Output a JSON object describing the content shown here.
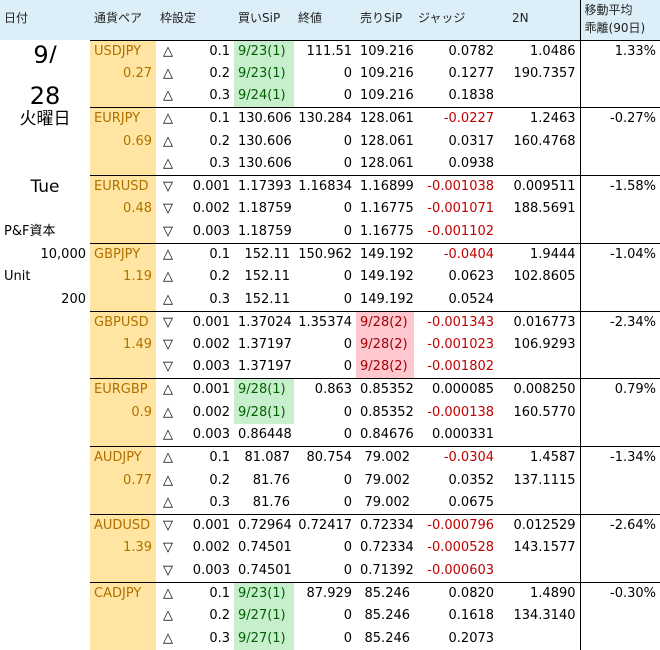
{
  "header": {
    "date": "日付",
    "pair": "通貨ペア",
    "frame": "枠設定",
    "buy_sip": "買いSiP",
    "close": "終値",
    "sell_sip": "売りSiP",
    "judge": "ジャッジ",
    "n2": "2N",
    "ma_line1": "移動平均",
    "ma_line2": "乖離(90日)"
  },
  "left_panel": {
    "date_top": "9/",
    "date_day": "28",
    "weekday_jp": "火曜日",
    "weekday_en": "Tue",
    "capital_label": "P&F資本",
    "capital_value": "10,000",
    "unit_label": "Unit",
    "unit_value": "200"
  },
  "colors": {
    "header_bg": "#dceef8",
    "pair_bg": "#ffe5a1",
    "pair_text": "#b07000",
    "green_bg": "#c7efcd",
    "green_text": "#006100",
    "red_bg": "#ffc7ce",
    "red_text": "#9c0006",
    "negative_text": "#c00000"
  },
  "groups": [
    {
      "pair": "USDJPY",
      "value": "0.27",
      "close": "111.51",
      "ma": "1.33%",
      "rows": [
        {
          "triangle": "△",
          "frame": "0.1",
          "buy": "9/23(1)",
          "buy_hl": "green",
          "sell": "109.216",
          "sell_hl": "",
          "judge": "0.0782",
          "n2": "1.0486"
        },
        {
          "triangle": "△",
          "frame": "0.2",
          "buy": "9/23(1)",
          "buy_hl": "green",
          "close": "0",
          "sell": "109.216",
          "sell_hl": "",
          "judge": "0.1277",
          "n2": "190.7357"
        },
        {
          "triangle": "△",
          "frame": "0.3",
          "buy": "9/24(1)",
          "buy_hl": "green",
          "close": "0",
          "sell": "109.216",
          "sell_hl": "",
          "judge": "0.1838",
          "n2": ""
        }
      ]
    },
    {
      "pair": "EURJPY",
      "value": "0.69",
      "close": "130.284",
      "ma": "-0.27%",
      "rows": [
        {
          "triangle": "△",
          "frame": "0.1",
          "buy": "130.606",
          "buy_hl": "",
          "sell": "128.061",
          "sell_hl": "",
          "judge": "-0.0227",
          "n2": "1.2463"
        },
        {
          "triangle": "△",
          "frame": "0.2",
          "buy": "130.606",
          "buy_hl": "",
          "close": "0",
          "sell": "128.061",
          "sell_hl": "",
          "judge": "0.0317",
          "n2": "160.4768"
        },
        {
          "triangle": "△",
          "frame": "0.3",
          "buy": "130.606",
          "buy_hl": "",
          "close": "0",
          "sell": "128.061",
          "sell_hl": "",
          "judge": "0.0938",
          "n2": ""
        }
      ]
    },
    {
      "pair": "EURUSD",
      "value": "0.48",
      "close": "1.16834",
      "ma": "-1.58%",
      "rows": [
        {
          "triangle": "▽",
          "frame": "0.001",
          "buy": "1.17393",
          "buy_hl": "",
          "sell": "1.16899",
          "sell_hl": "",
          "judge": "-0.001038",
          "n2": "0.009511"
        },
        {
          "triangle": "▽",
          "frame": "0.002",
          "buy": "1.18759",
          "buy_hl": "",
          "close": "0",
          "sell": "1.16775",
          "sell_hl": "",
          "judge": "-0.001071",
          "n2": "188.5691"
        },
        {
          "triangle": "▽",
          "frame": "0.003",
          "buy": "1.18759",
          "buy_hl": "",
          "close": "0",
          "sell": "1.16775",
          "sell_hl": "",
          "judge": "-0.001102",
          "n2": ""
        }
      ]
    },
    {
      "pair": "GBPJPY",
      "value": "1.19",
      "close": "150.962",
      "ma": "-1.04%",
      "rows": [
        {
          "triangle": "△",
          "frame": "0.1",
          "buy": "152.11",
          "buy_hl": "",
          "sell": "149.192",
          "sell_hl": "",
          "judge": "-0.0404",
          "n2": "1.9444"
        },
        {
          "triangle": "△",
          "frame": "0.2",
          "buy": "152.11",
          "buy_hl": "",
          "close": "0",
          "sell": "149.192",
          "sell_hl": "",
          "judge": "0.0623",
          "n2": "102.8605"
        },
        {
          "triangle": "△",
          "frame": "0.3",
          "buy": "152.11",
          "buy_hl": "",
          "close": "0",
          "sell": "149.192",
          "sell_hl": "",
          "judge": "0.0524",
          "n2": ""
        }
      ]
    },
    {
      "pair": "GBPUSD",
      "value": "1.49",
      "close": "1.35374",
      "ma": "-2.34%",
      "rows": [
        {
          "triangle": "▽",
          "frame": "0.001",
          "buy": "1.37024",
          "buy_hl": "",
          "sell": "9/28(2)",
          "sell_hl": "red",
          "judge": "-0.001343",
          "n2": "0.016773"
        },
        {
          "triangle": "▽",
          "frame": "0.002",
          "buy": "1.37197",
          "buy_hl": "",
          "close": "0",
          "sell": "9/28(2)",
          "sell_hl": "red",
          "judge": "-0.001023",
          "n2": "106.9293"
        },
        {
          "triangle": "▽",
          "frame": "0.003",
          "buy": "1.37197",
          "buy_hl": "",
          "close": "0",
          "sell": "9/28(2)",
          "sell_hl": "red",
          "judge": "-0.001802",
          "n2": ""
        }
      ]
    },
    {
      "pair": "EURGBP",
      "value": "0.9",
      "close": "0.863",
      "ma": "0.79%",
      "rows": [
        {
          "triangle": "△",
          "frame": "0.001",
          "buy": "9/28(1)",
          "buy_hl": "green",
          "sell": "0.85352",
          "sell_hl": "",
          "judge": "0.000085",
          "n2": "0.008250"
        },
        {
          "triangle": "△",
          "frame": "0.002",
          "buy": "9/28(1)",
          "buy_hl": "green",
          "close": "0",
          "sell": "0.85352",
          "sell_hl": "",
          "judge": "-0.000138",
          "n2": "160.5770"
        },
        {
          "triangle": "△",
          "frame": "0.003",
          "buy": "0.86448",
          "buy_hl": "",
          "close": "0",
          "sell": "0.84676",
          "sell_hl": "",
          "judge": "0.000331",
          "n2": ""
        }
      ]
    },
    {
      "pair": "AUDJPY",
      "value": "0.77",
      "close": "80.754",
      "ma": "-1.34%",
      "rows": [
        {
          "triangle": "△",
          "frame": "0.1",
          "buy": "81.087",
          "buy_hl": "",
          "sell": "79.002",
          "sell_hl": "",
          "judge": "-0.0304",
          "n2": "1.4587"
        },
        {
          "triangle": "△",
          "frame": "0.2",
          "buy": "81.76",
          "buy_hl": "",
          "close": "0",
          "sell": "79.002",
          "sell_hl": "",
          "judge": "0.0352",
          "n2": "137.1115"
        },
        {
          "triangle": "△",
          "frame": "0.3",
          "buy": "81.76",
          "buy_hl": "",
          "close": "0",
          "sell": "79.002",
          "sell_hl": "",
          "judge": "0.0675",
          "n2": ""
        }
      ]
    },
    {
      "pair": "AUDUSD",
      "value": "1.39",
      "close": "0.72417",
      "ma": "-2.64%",
      "rows": [
        {
          "triangle": "▽",
          "frame": "0.001",
          "buy": "0.72964",
          "buy_hl": "",
          "sell": "0.72334",
          "sell_hl": "",
          "judge": "-0.000796",
          "n2": "0.012529"
        },
        {
          "triangle": "▽",
          "frame": "0.002",
          "buy": "0.74501",
          "buy_hl": "",
          "close": "0",
          "sell": "0.72334",
          "sell_hl": "",
          "judge": "-0.000528",
          "n2": "143.1577"
        },
        {
          "triangle": "▽",
          "frame": "0.003",
          "buy": "0.74501",
          "buy_hl": "",
          "close": "0",
          "sell": "0.71392",
          "sell_hl": "",
          "judge": "-0.000603",
          "n2": ""
        }
      ]
    },
    {
      "pair": "CADJPY",
      "value": "",
      "close": "87.929",
      "ma": "-0.30%",
      "rows": [
        {
          "triangle": "△",
          "frame": "0.1",
          "buy": "9/23(1)",
          "buy_hl": "green",
          "sell": "85.246",
          "sell_hl": "",
          "judge": "0.0820",
          "n2": "1.4890"
        },
        {
          "triangle": "△",
          "frame": "0.2",
          "buy": "9/27(1)",
          "buy_hl": "green",
          "close": "0",
          "sell": "85.246",
          "sell_hl": "",
          "judge": "0.1618",
          "n2": "134.3140"
        },
        {
          "triangle": "△",
          "frame": "0.3",
          "buy": "9/27(1)",
          "buy_hl": "green",
          "close": "0",
          "sell": "85.246",
          "sell_hl": "",
          "judge": "0.2073",
          "n2": ""
        }
      ]
    }
  ]
}
